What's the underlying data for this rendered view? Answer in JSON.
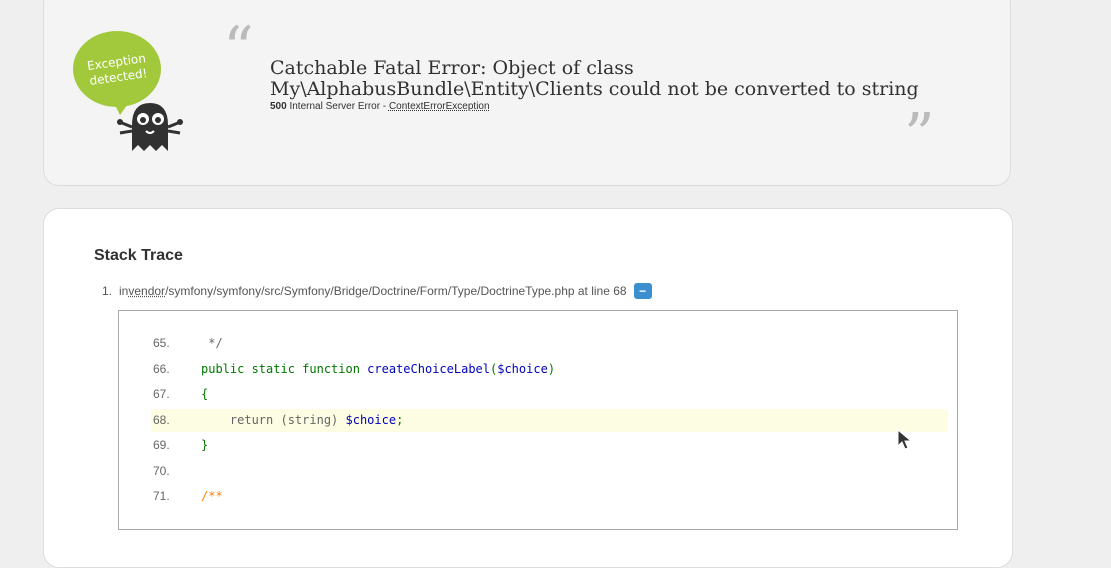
{
  "error": {
    "title": "Catchable Fatal Error: Object of class My\\AlphabusBundle\\Entity\\Clients could not be converted to string",
    "status_code": "500",
    "status_text": "Internal Server Error - ",
    "exception_class": "ContextErrorException",
    "logo_text_line1": "Exception",
    "logo_text_line2": "detected!"
  },
  "stack_trace": {
    "title": "Stack Trace",
    "items": [
      {
        "number": "1.",
        "prefix": "in ",
        "vendor": "vendor",
        "path": "/symfony/symfony/src/Symfony/Bridge/Doctrine/Form/Type/DoctrineType.php at line 68",
        "toggle": "−"
      }
    ]
  },
  "code": {
    "lines": [
      {
        "number": "65.",
        "parts": [
          {
            "t": " */",
            "c": "plain"
          }
        ]
      },
      {
        "number": "66.",
        "parts": [
          {
            "t": "public static function ",
            "c": "kw"
          },
          {
            "t": "createChoiceLabel",
            "c": "fn"
          },
          {
            "t": "(",
            "c": "kw"
          },
          {
            "t": "$choice",
            "c": "var"
          },
          {
            "t": ")",
            "c": "kw"
          }
        ]
      },
      {
        "number": "67.",
        "parts": [
          {
            "t": "{",
            "c": "kw"
          }
        ]
      },
      {
        "number": "68.",
        "selected": true,
        "parts": [
          {
            "t": "    return (string) ",
            "c": "plain"
          },
          {
            "t": "$choice",
            "c": "var"
          },
          {
            "t": ";",
            "c": "kw"
          }
        ]
      },
      {
        "number": "69.",
        "parts": [
          {
            "t": "}",
            "c": "kw"
          }
        ]
      },
      {
        "number": "70.",
        "parts": []
      },
      {
        "number": "71.",
        "parts": [
          {
            "t": "/**",
            "c": "comment"
          }
        ]
      }
    ]
  },
  "colors": {
    "logo_green": "#a1c93b",
    "ghost": "#313131",
    "toggle_blue": "#3b8fcf",
    "highlight": "#fdfde3"
  }
}
